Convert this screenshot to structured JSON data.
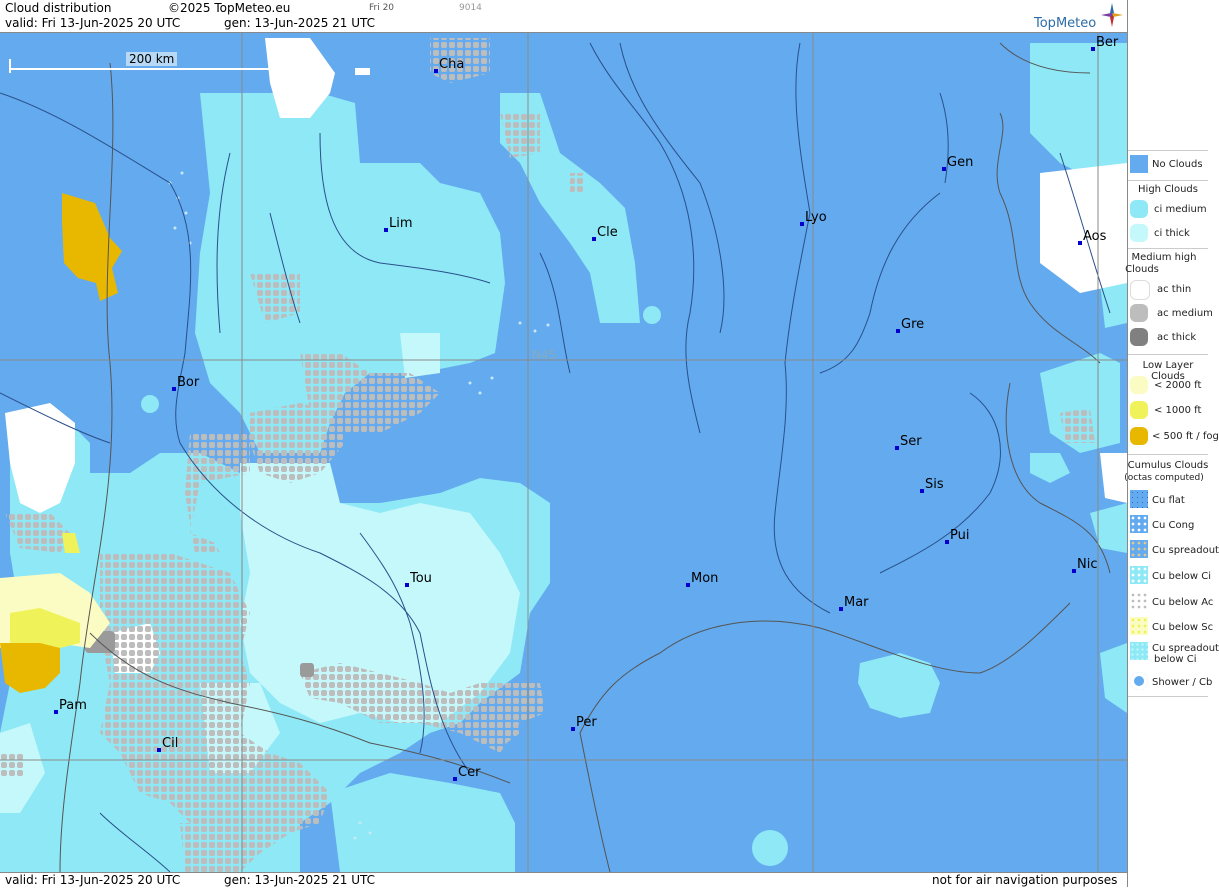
{
  "header": {
    "title": "Cloud distribution",
    "copyright": "©2025 TopMeteo.eu",
    "frame_label": "Fri 20",
    "code": "9014",
    "valid": "valid:  Fri  13-Jun-2025  20 UTC",
    "generated": "gen: 13-Jun-2025 21 UTC",
    "brand": "TopMeteo"
  },
  "footer": {
    "valid": "valid:  Fri  13-Jun-2025  20 UTC",
    "generated": "gen: 13-Jun-2025 21 UTC",
    "disclaimer": "not for air navigation purposes"
  },
  "map": {
    "scale_label": "200 km",
    "latitude_label": "N45",
    "cities": [
      "Cha",
      "Ber",
      "Lim",
      "Cle",
      "Lyo",
      "Gen",
      "Aos",
      "Gre",
      "Bor",
      "Ser",
      "Sis",
      "Pui",
      "Tou",
      "Mon",
      "Mar",
      "Nic",
      "Pam",
      "Cil",
      "Per",
      "Cer"
    ]
  },
  "legend": {
    "no_clouds": "No Clouds",
    "high_clouds": "High Clouds",
    "ci_medium": "ci medium",
    "ci_thick": "ci thick",
    "medium_high_1": "Medium high",
    "medium_high_2": "Clouds",
    "ac_thin": "ac thin",
    "ac_medium": "ac medium",
    "ac_thick": "ac thick",
    "low_layer": "Low Layer Clouds",
    "lt2000": "< 2000 ft",
    "lt1000": "< 1000 ft",
    "lt500": "< 500 ft / fog",
    "cumulus_1": "Cumulus Clouds",
    "cumulus_2": "(octas computed)",
    "cu_flat": "Cu flat",
    "cu_cong": "Cu Cong",
    "cu_spread": "Cu spreadout",
    "cu_below_ci": "Cu below Ci",
    "cu_below_ac": "Cu below Ac",
    "cu_below_sc": "Cu below Sc",
    "cu_spread_ci_1": "Cu spreadout",
    "cu_spread_ci_2": "below Ci",
    "shower": "Shower / Cb"
  },
  "colors": {
    "no_clouds": "#63aaee",
    "ci_medium": "#8ee8f5",
    "ci_thick": "#c5f8fb",
    "ac_thin": "#ffffff",
    "ac_medium": "#bdbdbd",
    "ac_thick": "#808080",
    "lt2000": "#fafcc4",
    "lt1000": "#f0f25a",
    "lt500": "#e8b800",
    "grid": "#8a8a8a",
    "border": "#555555",
    "river": "#2a4f8a",
    "city": "#0000cc"
  }
}
